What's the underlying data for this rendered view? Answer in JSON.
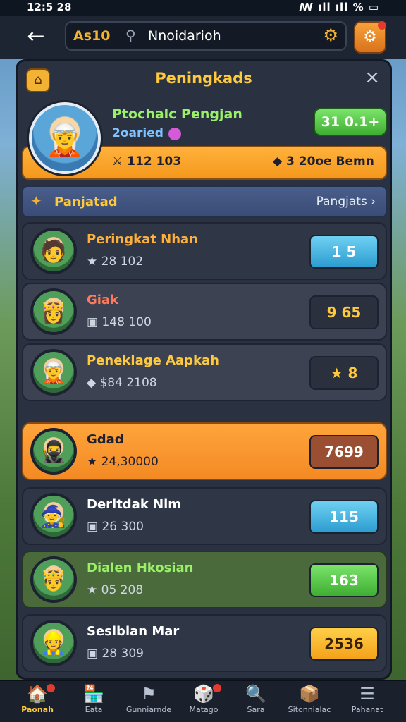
{
  "status": {
    "time": "12:5 28",
    "signal": "ꟿ ıll ıll % ▭"
  },
  "topbar": {
    "level": "As10",
    "search_value": "Nnoidarioh"
  },
  "panel": {
    "title": "Peningkads"
  },
  "hero": {
    "name": "Ptochalc Pengjan",
    "sub": "2oaried",
    "button": "31 0.1+",
    "stat1": "112 103",
    "stat2": "3  20oe Bemn"
  },
  "section": {
    "label": "Panjatad",
    "link": "Pangjats ›"
  },
  "rows": [
    {
      "name": "Peringkat Nhan",
      "stat": "28 102",
      "button": "1 5"
    },
    {
      "name": "Giak",
      "stat": "148 100",
      "button": "9 65"
    },
    {
      "name": "Penekiage Aapkah",
      "stat": "$84 2108",
      "button": "8"
    },
    {
      "name": "Gdad",
      "stat": "24,30000",
      "button": "7699"
    },
    {
      "name": "Deritdak Nim",
      "stat": "26 300",
      "button": "115"
    },
    {
      "name": "Dialen Hkosian",
      "stat": "05 208",
      "button": "163"
    },
    {
      "name": "Sesibian Mar",
      "stat": "28 309",
      "button": "2536"
    }
  ],
  "nav": [
    {
      "label": "Paonah",
      "icon": "home-icon"
    },
    {
      "label": "Eata",
      "icon": "shop-icon"
    },
    {
      "label": "Gunniarnde",
      "icon": "flag-icon"
    },
    {
      "label": "Matago",
      "icon": "chest-icon"
    },
    {
      "label": "Sara",
      "icon": "search-icon"
    },
    {
      "label": "Sitonnialac",
      "icon": "box-icon"
    },
    {
      "label": "Pahanat",
      "icon": "menu-icon"
    }
  ]
}
